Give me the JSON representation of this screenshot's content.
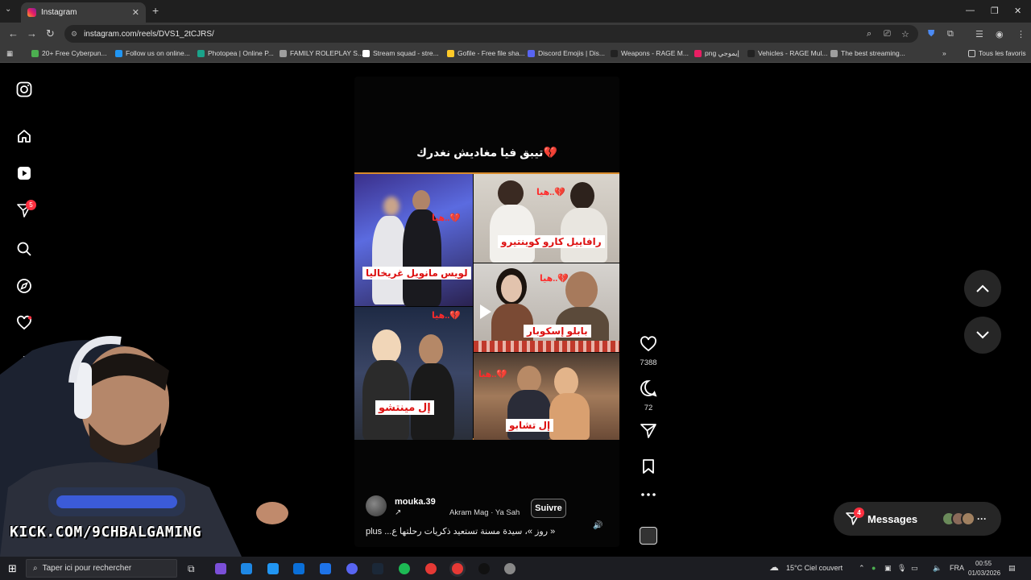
{
  "browser": {
    "tab_title": "Instagram",
    "url": "instagram.com/reels/DVS1_2tCJRS/",
    "bookmarks": [
      {
        "label": "20+ Free Cyberpun...",
        "color": "#4caf50"
      },
      {
        "label": "Follow us on online...",
        "color": "#2196f3"
      },
      {
        "label": "Photopea | Online P...",
        "color": "#1aa38a"
      },
      {
        "label": "FAMILY ROLEPLAY S...",
        "color": "#9e9e9e"
      },
      {
        "label": "Stream squad - stre...",
        "color": "#ffffff"
      },
      {
        "label": "Gofile - Free file sha...",
        "color": "#ffca28"
      },
      {
        "label": "Discord Emojis | Dis...",
        "color": "#5865f2"
      },
      {
        "label": "Weapons - RAGE M...",
        "color": "#222222"
      },
      {
        "label": "png إيموجي",
        "color": "#e91e63"
      },
      {
        "label": "Vehicles - RAGE Mul...",
        "color": "#222222"
      },
      {
        "label": "The best streaming...",
        "color": "#9e9e9e"
      }
    ],
    "all_bookmarks": "Tous les favoris"
  },
  "sidebar": {
    "notification_count": "5"
  },
  "reel": {
    "top_caption": "تيبق فيا مغاديش نغدرك💔",
    "cells": [
      {
        "label": "لويس مانويل غريخاليا",
        "hey": "هيا..💔"
      },
      {
        "label": "رافاييل كارو كوينتيرو",
        "hey": "هيا..💔"
      },
      {
        "label": "بابلو إسكوبار",
        "hey": "هيا..💔"
      },
      {
        "label": "إل مينتشو",
        "hey": "هيا..💔"
      },
      {
        "label": "إل تشابو",
        "hey": "هيا..💔"
      }
    ],
    "author": "mouka.39",
    "follow": "Suivre",
    "audio": "Akram Mag · Ya Sah",
    "description": "« روز »، سيدة مسنة تستعيد ذكريات رحلتها ع... plus"
  },
  "actions": {
    "likes": "7388",
    "comments": "72"
  },
  "messages": {
    "label": "Messages",
    "count": "4"
  },
  "overlay": {
    "kick_text": "KICK.COM/9CHBALGAMING"
  },
  "taskbar": {
    "search_placeholder": "Taper ici pour rechercher",
    "weather": "15°C  Ciel couvert",
    "lang": "FRA",
    "time": "00:55",
    "date": "01/03/2026"
  }
}
